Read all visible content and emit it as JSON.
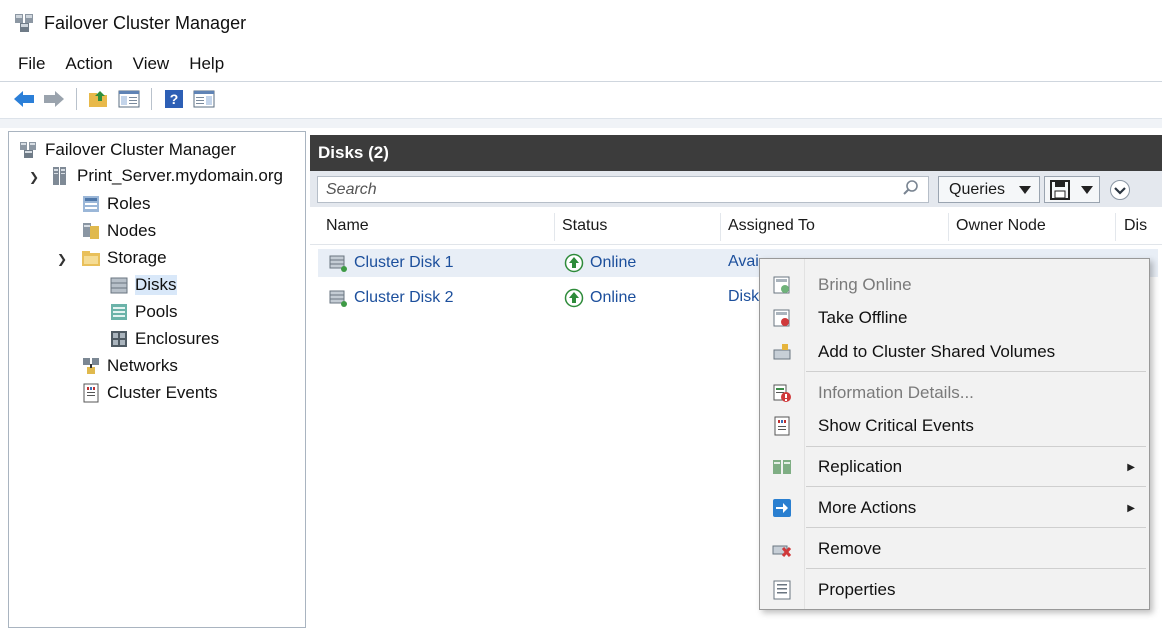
{
  "window": {
    "title": "Failover Cluster Manager"
  },
  "menu": [
    "File",
    "Action",
    "View",
    "Help"
  ],
  "toolbar": {
    "icons": [
      "back-icon",
      "forward-icon",
      "up-folder-icon",
      "show-hide-tree-icon",
      "help-icon",
      "show-hide-action-pane-icon"
    ]
  },
  "tree": {
    "root": "Failover Cluster Manager",
    "cluster": "Print_Server.mydomain.org",
    "items": {
      "roles": "Roles",
      "nodes": "Nodes",
      "storage": "Storage",
      "disks": "Disks",
      "pools": "Pools",
      "enclosures": "Enclosures",
      "networks": "Networks",
      "events": "Cluster Events"
    }
  },
  "main": {
    "header": "Disks (2)",
    "search_placeholder": "Search",
    "queries_label": "Queries",
    "columns": [
      "Name",
      "Status",
      "Assigned To",
      "Owner Node",
      "Dis"
    ],
    "rows": [
      {
        "name": "Cluster Disk 1",
        "status": "Online",
        "assigned": "Avai",
        "owner": ""
      },
      {
        "name": "Cluster Disk 2",
        "status": "Online",
        "assigned": "Disk",
        "owner": ""
      }
    ]
  },
  "context_menu": {
    "items": [
      {
        "label": "Bring Online",
        "icon": "bring-online-icon",
        "disabled": true
      },
      {
        "label": "Take Offline",
        "icon": "take-offline-icon",
        "disabled": false
      },
      {
        "label": "Add to Cluster Shared Volumes",
        "icon": "add-csv-icon",
        "disabled": false
      },
      {
        "label": "Information Details...",
        "icon": "info-details-icon",
        "disabled": true
      },
      {
        "label": "Show Critical Events",
        "icon": "critical-events-icon",
        "disabled": false
      },
      {
        "label": "Replication",
        "icon": "replication-icon",
        "disabled": false,
        "submenu": true
      },
      {
        "label": "More Actions",
        "icon": "more-actions-icon",
        "disabled": false,
        "submenu": true
      },
      {
        "label": "Remove",
        "icon": "remove-icon",
        "disabled": false
      },
      {
        "label": "Properties",
        "icon": "properties-icon",
        "disabled": false
      }
    ]
  },
  "colors": {
    "header_bg": "#3c3c3c",
    "link": "#1c4f9c",
    "online_green": "#2e8b3a",
    "selection": "#d9e8f9"
  }
}
